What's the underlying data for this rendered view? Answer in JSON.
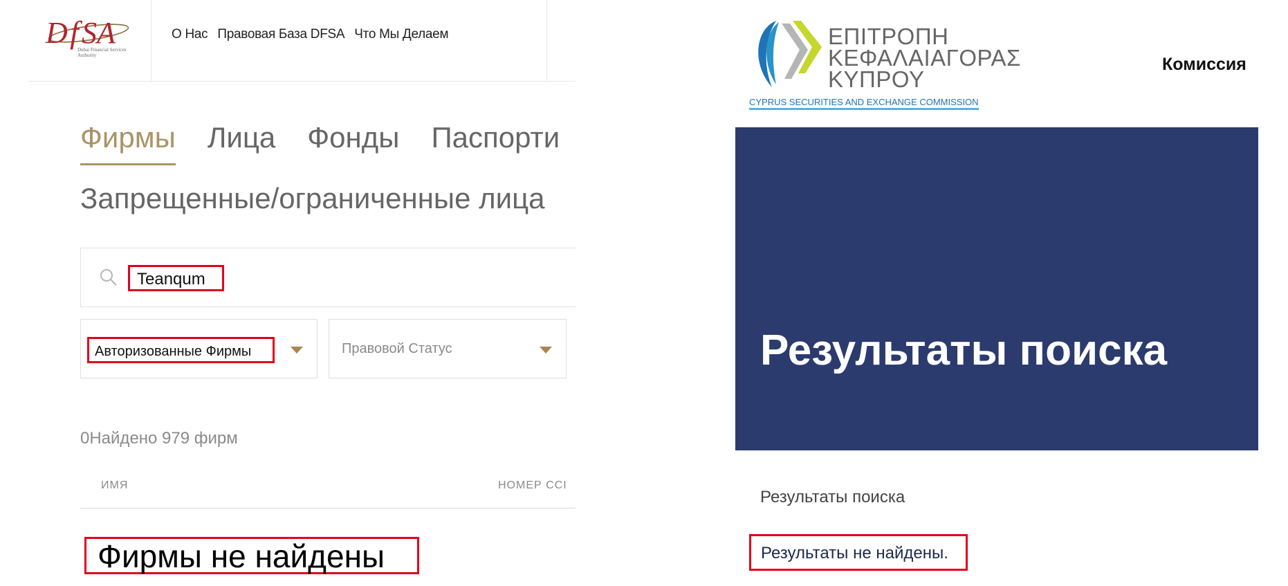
{
  "left_panel": {
    "logo": {
      "wordmark": "DFSA",
      "subtitle": "Dubai Financial Services Authority",
      "colors": {
        "primary": "#b0262c",
        "accent": "#8c6b3b"
      }
    },
    "nav": [
      "О Нас",
      "Правовая База DFSA",
      "Что Мы Делаем"
    ],
    "tabs": [
      "Фирмы",
      "Лица",
      "Фонды",
      "Паспорти"
    ],
    "active_tab": "Фирмы",
    "restricted_tab": "Запрещенные/ограниченные лица",
    "search": {
      "value": "Teanqum"
    },
    "filters": {
      "type": "Авторизованные Фирмы",
      "status_placeholder": "Правовой Статус"
    },
    "results_count": "0Найдено 979 фирм",
    "columns": {
      "name": "ИМЯ",
      "number": "НОМЕР ССІ"
    },
    "empty_message": "Фирмы не найдены",
    "colors": {
      "accent": "#a99466",
      "highlight": "#e3001b"
    }
  },
  "right_panel": {
    "logo": {
      "lines": [
        "ΕΠΙΤΡΟΠΗ",
        "ΚΕΦΑΛΑΙΑΓΟΡΑΣ",
        "ΚΥΠΡΟΥ"
      ],
      "english": "CYPRUS SECURITIES AND EXCHANGE COMMISSION"
    },
    "nav_item": "Комиссия",
    "banner_title": "Результаты поиска",
    "breadcrumb": "Результаты поиска",
    "empty_message": "Результаты не найдены.",
    "colors": {
      "banner": "#2b3b6e",
      "highlight": "#e3001b"
    }
  }
}
